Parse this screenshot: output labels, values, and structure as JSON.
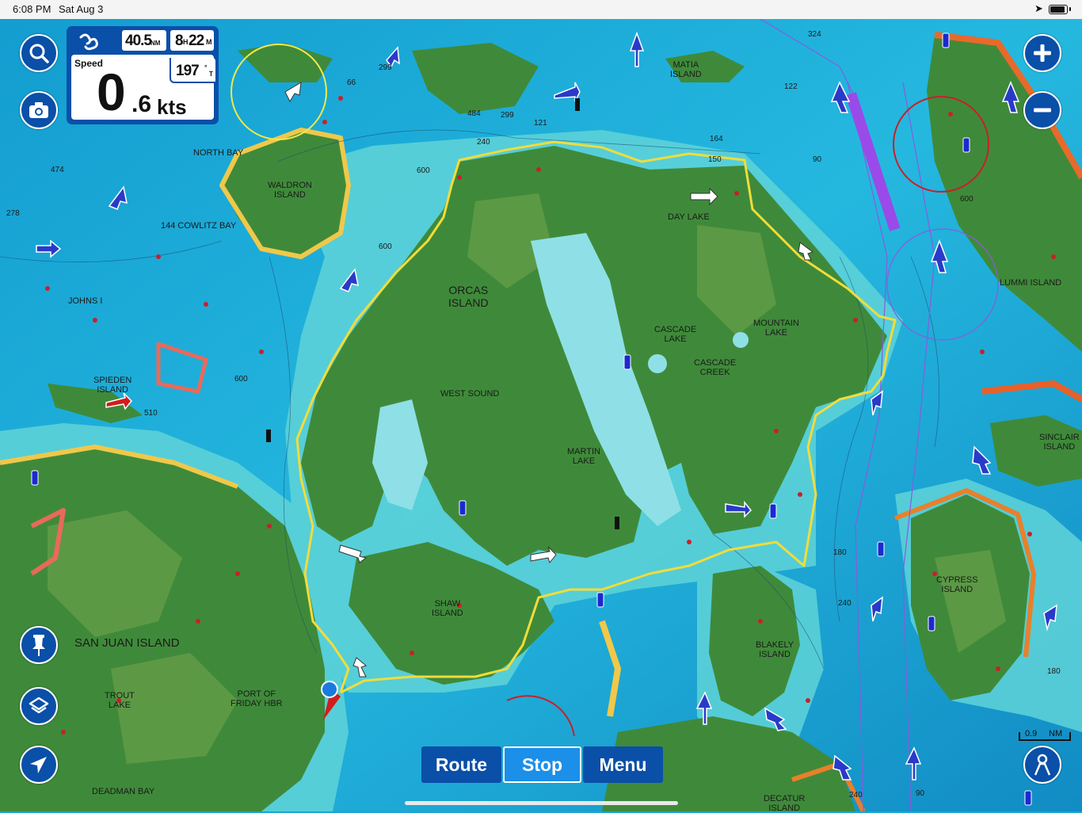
{
  "status_bar": {
    "time": "6:08 PM",
    "date": "Sat Aug 3"
  },
  "dashboard": {
    "distance": "40.5",
    "distance_unit": "NM",
    "time_hours": "8",
    "time_hours_unit": "H",
    "time_minutes": "22",
    "time_minutes_unit": "M",
    "speed_label": "Speed",
    "speed_int": "0",
    "speed_dec": ".6",
    "speed_unit": "kts",
    "heading": "197",
    "heading_unit": "°",
    "heading_ref": "T"
  },
  "bottom_bar": {
    "route": "Route",
    "stop": "Stop",
    "menu": "Menu"
  },
  "scale": {
    "value": "0.9",
    "unit": "NM"
  },
  "map_labels": {
    "orcas": "ORCAS\nISLAND",
    "san_juan": "SAN JUAN ISLAND",
    "north_bay": "NORTH BAY",
    "waldron": "WALDRON\nISLAND",
    "cowlitz": "144 COWLITZ BAY",
    "johns": "JOHNS I",
    "spieden": "SPIEDEN\nISLAND",
    "west_sound": "WEST SOUND",
    "martin_lake": "MARTIN\nLAKE",
    "cascade_lake": "CASCADE\nLAKE",
    "cascade_creek": "CASCADE\nCREEK",
    "mountain_lake": "MOUNTAIN\nLAKE",
    "day_lake": "DAY LAKE",
    "matia": "MATIA\nISLAND",
    "lummi": "LUMMI ISLAND",
    "sinclair": "SINCLAIR\nISLAND",
    "cypress": "CYPRESS\nISLAND",
    "blakely": "BLAKELY\nISLAND",
    "shaw": "SHAW\nISLAND",
    "port_of_friday": "PORT OF\nFRIDAY HBR",
    "trout_lake": "TROUT\nLAKE",
    "deadman_bay": "DEADMAN BAY",
    "decatur": "DECATUR\nISLAND"
  },
  "depths": [
    "324",
    "66",
    "299",
    "484",
    "299",
    "121",
    "240",
    "600",
    "474",
    "600",
    "600",
    "278",
    "164",
    "150",
    "122",
    "90",
    "600",
    "180",
    "240",
    "180",
    "240",
    "90",
    "510"
  ],
  "colors": {
    "button_blue": "#0a4fa8",
    "stop_active": "#1c8fe8",
    "track_yellow": "#f2dc3a"
  }
}
